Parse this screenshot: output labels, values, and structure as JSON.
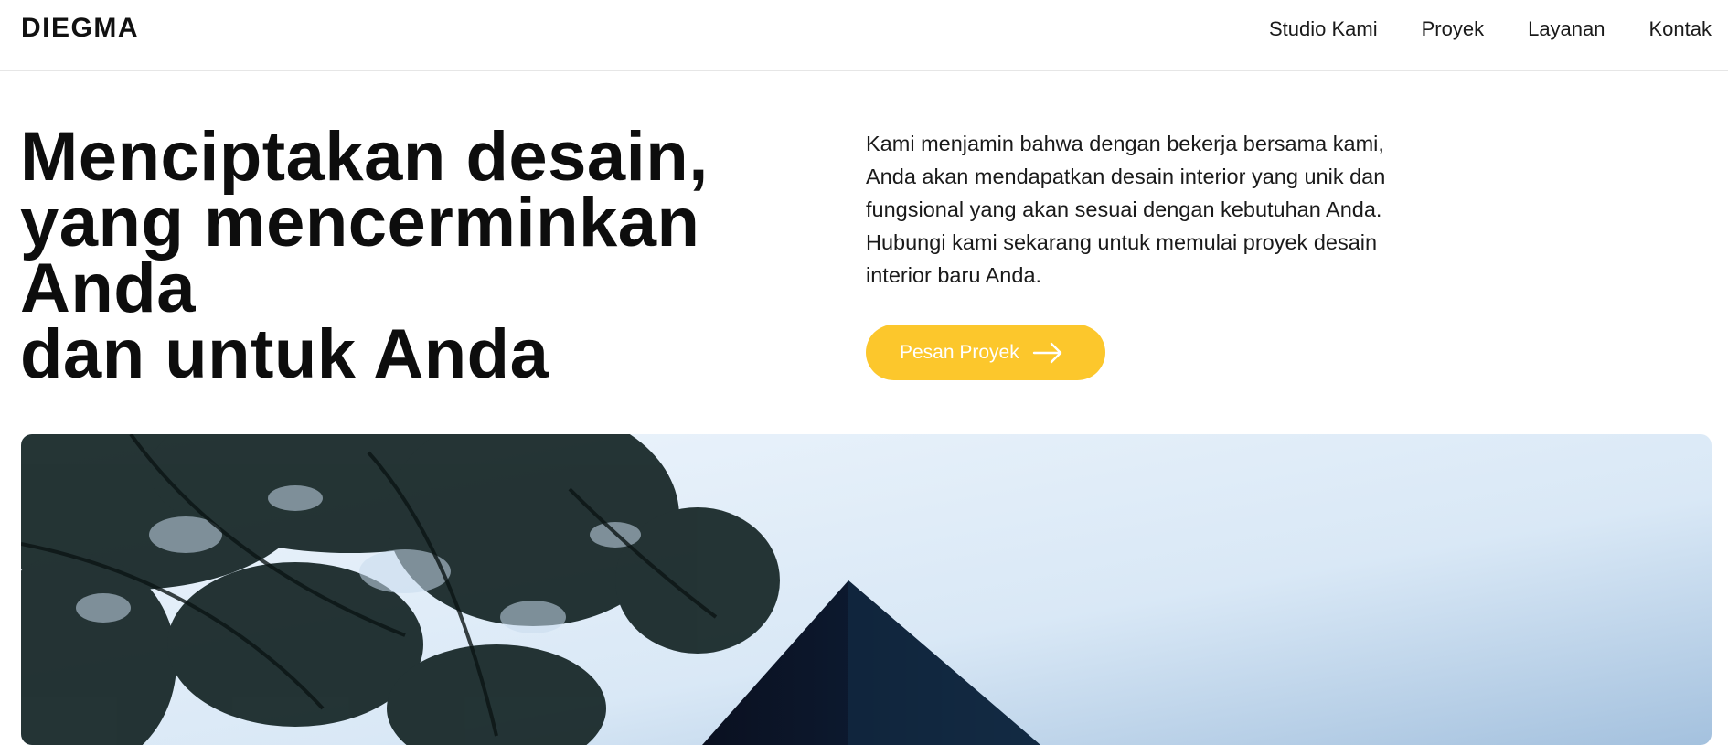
{
  "brand": {
    "logo": "DIEGMA"
  },
  "nav": {
    "items": [
      {
        "label": "Studio Kami"
      },
      {
        "label": "Proyek"
      },
      {
        "label": "Layanan"
      },
      {
        "label": "Kontak"
      }
    ]
  },
  "hero": {
    "headline_lines": [
      "Menciptakan desain,",
      "yang mencerminkan",
      "Anda",
      "dan untuk Anda"
    ],
    "description_lines": [
      "Kami menjamin bahwa dengan bekerja bersama kami,",
      "Anda akan mendapatkan desain interior yang unik dan",
      "fungsional yang akan sesuai dengan kebutuhan Anda.",
      "Hubungi kami sekarang untuk memulai proyek desain",
      "interior baru Anda."
    ],
    "cta_label": "Pesan Proyek",
    "cta_icon": "arrow-right-icon"
  },
  "colors": {
    "accent": "#fcc72c",
    "text": "#111111",
    "background": "#ffffff",
    "sky_top": "#a9c6e2",
    "sky_light": "#eaf3fb",
    "building": "#0b1220"
  }
}
